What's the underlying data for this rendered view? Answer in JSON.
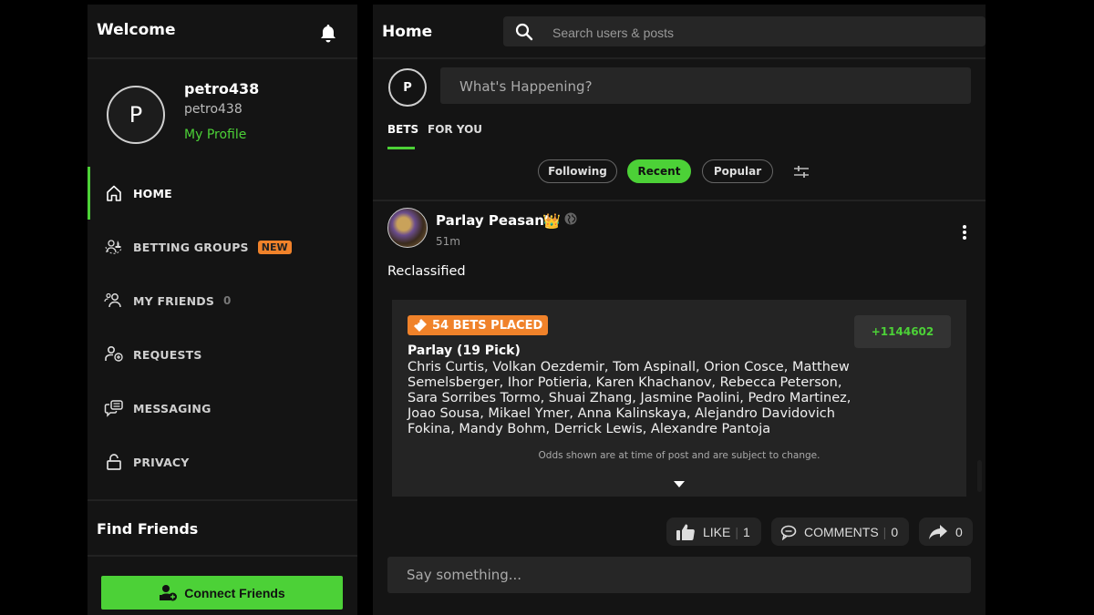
{
  "sidebar": {
    "title": "Welcome",
    "profile": {
      "avatar_initial": "P",
      "display_name": "petro438",
      "username": "petro438",
      "profile_link": "My Profile"
    },
    "nav": [
      {
        "label": "HOME",
        "icon": "home-icon",
        "active": true
      },
      {
        "label": "BETTING GROUPS",
        "icon": "betting-groups-icon",
        "badge": "NEW"
      },
      {
        "label": "MY FRIENDS",
        "icon": "friends-icon",
        "count": "0"
      },
      {
        "label": "REQUESTS",
        "icon": "add-user-icon"
      },
      {
        "label": "MESSAGING",
        "icon": "chat-icon"
      },
      {
        "label": "PRIVACY",
        "icon": "lock-icon"
      }
    ],
    "find_friends_title": "Find Friends",
    "connect_button": "Connect Friends"
  },
  "main": {
    "title": "Home",
    "search_placeholder": "Search users & posts",
    "compose": {
      "avatar_initial": "P",
      "placeholder": "What's Happening?"
    },
    "tabs": [
      {
        "label": "BETS",
        "active": true
      },
      {
        "label": "FOR YOU",
        "active": false
      }
    ],
    "filters": [
      {
        "label": "Following",
        "active": false
      },
      {
        "label": "Recent",
        "active": true
      },
      {
        "label": "Popular",
        "active": false
      }
    ],
    "post": {
      "author": "Parlay Peasant",
      "author_emoji": "👑",
      "time": "51m",
      "text": "Reclassified",
      "bet": {
        "badge": "54 BETS PLACED",
        "type": "Parlay (19 Pick)",
        "picks": "Chris Curtis, Volkan Oezdemir, Tom Aspinall, Orion Cosce, Matthew Semelsberger, Ihor Potieria, Karen Khachanov, Rebecca Peterson, Sara Sorribes Tormo, Shuai Zhang, Jasmine Paolini, Pedro Martinez, Joao Sousa, Mikael Ymer, Anna Kalinskaya, Alejandro Davidovich Fokina, Mandy Bohm, Derrick Lewis, Alexandre Pantoja",
        "odds": "+1144602",
        "note": "Odds shown are at time of post and are subject to change."
      },
      "actions": {
        "like_label": "LIKE",
        "like_count": "1",
        "comments_label": "COMMENTS",
        "comments_count": "0",
        "share_count": "0"
      },
      "reply_placeholder": "Say something..."
    }
  },
  "colors": {
    "accent": "#4cd137",
    "badge_orange": "#f0822a",
    "panel": "#141414",
    "card": "#242424"
  }
}
